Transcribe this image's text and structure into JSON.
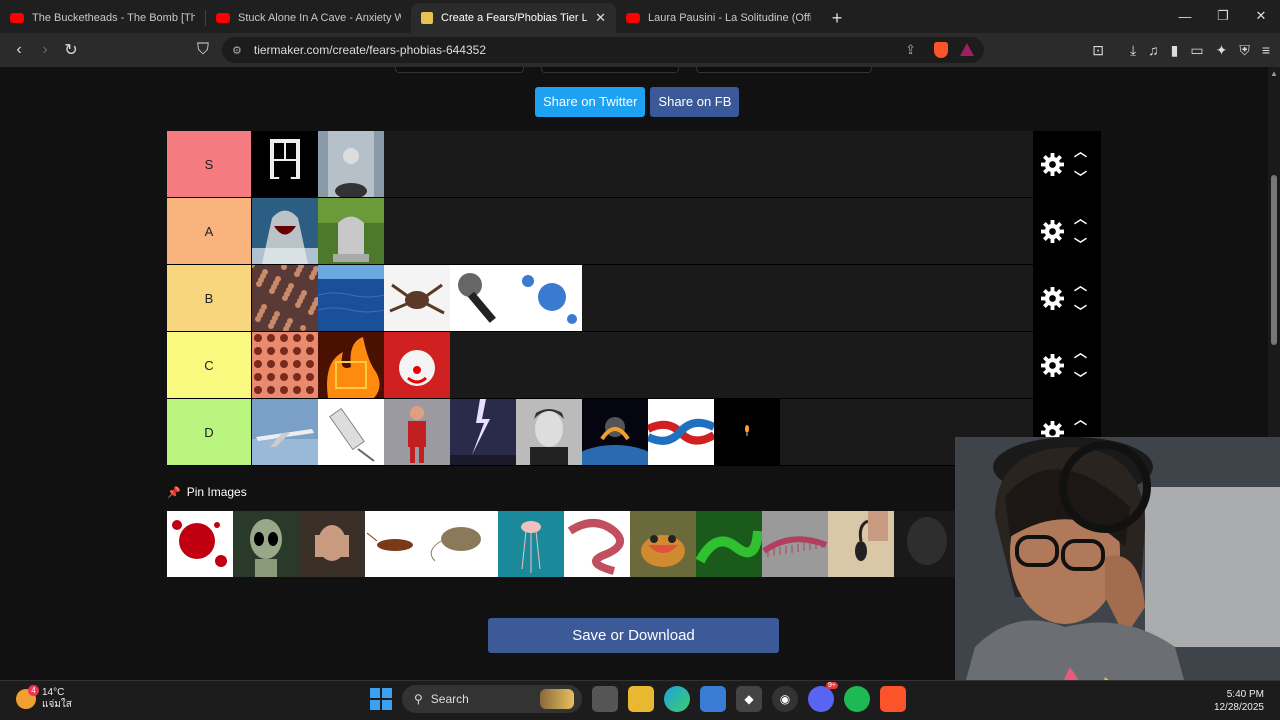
{
  "browser": {
    "tabs": [
      {
        "title": "The Bucketheads - The Bomb [These",
        "active": false
      },
      {
        "title": "Stuck Alone In A Cave - Anxiety Warr",
        "active": false
      },
      {
        "title": "Create a Fears/Phobias Tier List - ",
        "active": true
      },
      {
        "title": "Laura Pausini - La Solitudine (Official",
        "active": false
      }
    ],
    "url": "tiermaker.com/create/fears-phobias-644352",
    "brave_badge": "1"
  },
  "page": {
    "share_twitter": "Share on Twitter",
    "share_fb": "Share on FB",
    "tiers": [
      {
        "label": "S",
        "color": "#f47b80",
        "items": [
          "window-silhouette",
          "high-place-pov"
        ]
      },
      {
        "label": "A",
        "color": "#f9b37c",
        "items": [
          "shark",
          "gravestone"
        ]
      },
      {
        "label": "B",
        "color": "#f8d67e",
        "items": [
          "crowd",
          "ocean",
          "tarantula",
          "microphone",
          "virus"
        ]
      },
      {
        "label": "C",
        "color": "#fafa80",
        "items": [
          "holes-trypophobia",
          "fire",
          "clown"
        ]
      },
      {
        "label": "D",
        "color": "#baf57f",
        "items": [
          "airplane",
          "syringe",
          "puppet",
          "lightning",
          "man-portrait",
          "asteroid-earth",
          "knot",
          "candle-dark"
        ]
      }
    ],
    "pin_label": "Pin Images",
    "pool": [
      "blood",
      "alien",
      "scared-woman",
      "cockroach-mouse",
      "jellyfish",
      "worm",
      "frog",
      "green-snake",
      "centipede",
      "scorpion",
      "dark-fog"
    ],
    "save_label": "Save or Download"
  },
  "taskbar": {
    "temp": "14°C",
    "weather": "แจ่มใส",
    "weather_badge": "4",
    "search": "Search",
    "discord_badge": "9+",
    "time": "5:40 PM",
    "date": "12/28/2025"
  }
}
